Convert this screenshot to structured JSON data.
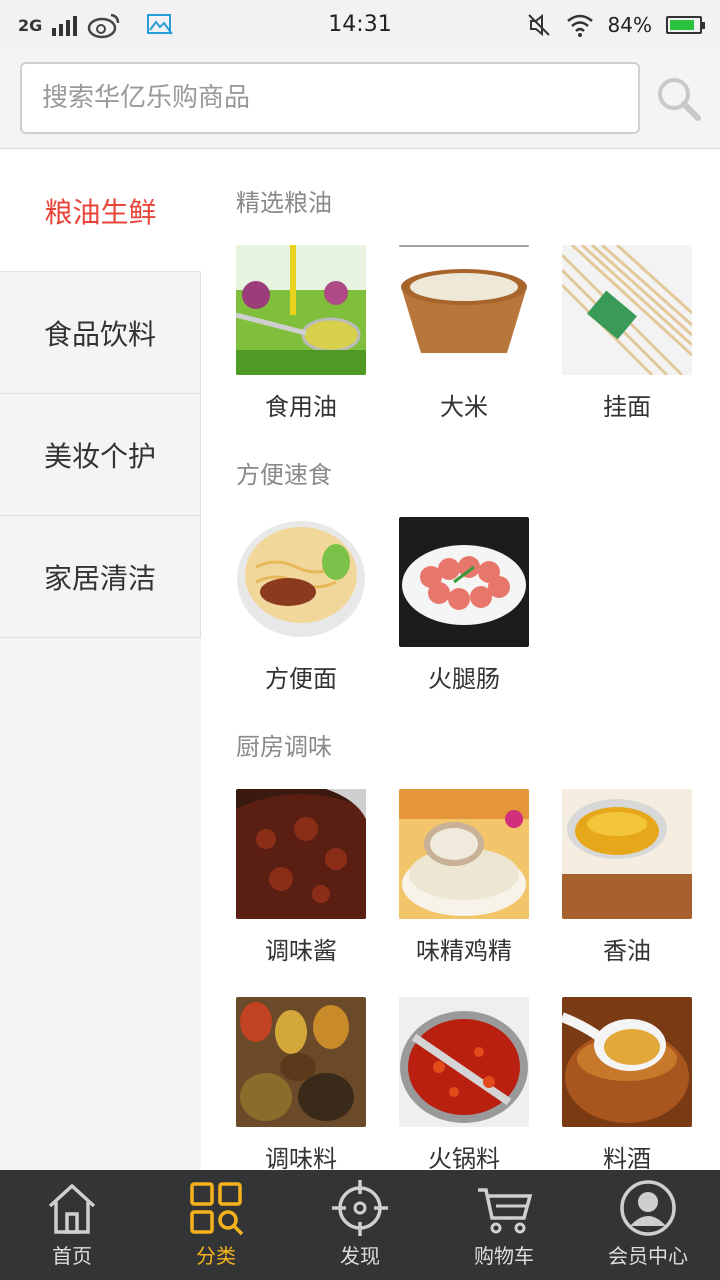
{
  "status_bar": {
    "network": "2G",
    "time": "14:31",
    "battery_percent": "84%",
    "battery_level": 0.84,
    "icons": [
      "signal-icon",
      "weibo-icon",
      "gallery-icon",
      "mute-icon",
      "wifi-icon",
      "battery-icon"
    ]
  },
  "search": {
    "placeholder": "搜索华亿乐购商品",
    "button_icon": "search-icon"
  },
  "sidebar": {
    "items": [
      {
        "label": "粮油生鲜",
        "active": true
      },
      {
        "label": "食品饮料",
        "active": false
      },
      {
        "label": "美妆个护",
        "active": false
      },
      {
        "label": "家居清洁",
        "active": false
      }
    ]
  },
  "sections": [
    {
      "title": "精选粮油",
      "products": [
        {
          "label": "食用油",
          "image": "oil-image"
        },
        {
          "label": "大米",
          "image": "rice-image"
        },
        {
          "label": "挂面",
          "image": "noodles-image"
        }
      ]
    },
    {
      "title": "方便速食",
      "products": [
        {
          "label": "方便面",
          "image": "instant-noodles-image"
        },
        {
          "label": "火腿肠",
          "image": "ham-sausage-image"
        }
      ]
    },
    {
      "title": "厨房调味",
      "products": [
        {
          "label": "调味酱",
          "image": "sauce-image"
        },
        {
          "label": "味精鸡精",
          "image": "msg-image"
        },
        {
          "label": "香油",
          "image": "sesame-oil-image"
        },
        {
          "label": "调味料",
          "image": "spices-image"
        },
        {
          "label": "火锅料",
          "image": "hotpot-image"
        },
        {
          "label": "料酒",
          "image": "cooking-wine-image"
        }
      ]
    }
  ],
  "tabbar": {
    "active_color": "#f5b31b",
    "items": [
      {
        "label": "首页",
        "icon": "home-icon",
        "active": false
      },
      {
        "label": "分类",
        "icon": "category-icon",
        "active": true
      },
      {
        "label": "发现",
        "icon": "discover-icon",
        "active": false
      },
      {
        "label": "购物车",
        "icon": "cart-icon",
        "active": false
      },
      {
        "label": "会员中心",
        "icon": "user-icon",
        "active": false
      }
    ]
  }
}
